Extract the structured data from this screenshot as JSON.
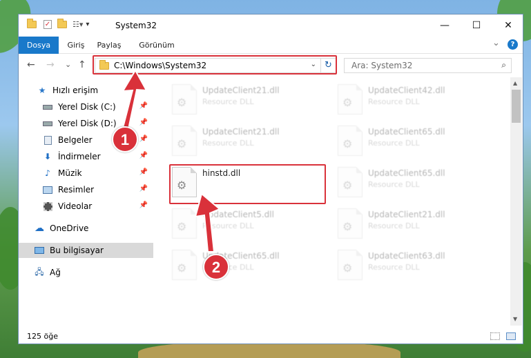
{
  "window": {
    "title": "System32",
    "controls": {
      "minimize": "—",
      "maximize": "☐",
      "close": "✕"
    }
  },
  "ribbon": {
    "tabs": [
      {
        "label": "Dosya"
      },
      {
        "label": "Giriş"
      },
      {
        "label": "Paylaş"
      },
      {
        "label": "Görünüm"
      }
    ],
    "help_label": "?",
    "expand_label": "⌄"
  },
  "navigation": {
    "back": "←",
    "forward": "→",
    "recent": "⌄",
    "up": "↑",
    "address": "C:\\Windows\\System32",
    "refresh": "↻",
    "search_placeholder": "Ara: System32",
    "search_icon": "⌕"
  },
  "sidebar": {
    "items": [
      {
        "label": "Hızlı erişim",
        "icon": "star-icon"
      },
      {
        "label": "Yerel Disk (C:)",
        "icon": "drive-icon",
        "pinned": true
      },
      {
        "label": "Yerel Disk (D:)",
        "icon": "drive-icon",
        "pinned": true
      },
      {
        "label": "Belgeler",
        "icon": "documents-icon",
        "pinned": true
      },
      {
        "label": "İndirmeler",
        "icon": "download-icon",
        "pinned": true
      },
      {
        "label": "Müzik",
        "icon": "music-icon",
        "pinned": true
      },
      {
        "label": "Resimler",
        "icon": "pictures-icon",
        "pinned": true
      },
      {
        "label": "Videolar",
        "icon": "videos-icon",
        "pinned": true
      },
      {
        "label": "OneDrive",
        "icon": "cloud-icon"
      },
      {
        "label": "Bu bilgisayar",
        "icon": "computer-icon",
        "selected": true
      },
      {
        "label": "Ağ",
        "icon": "network-icon"
      }
    ]
  },
  "files": [
    {
      "name": "UpdateClient21.dll",
      "desc": "Resource DLL"
    },
    {
      "name": "UpdateClient42.dll",
      "desc": "Resource DLL"
    },
    {
      "name": "UpdateClient21.dll",
      "desc": "Resource DLL"
    },
    {
      "name": "UpdateClient65.dll",
      "desc": "Resource DLL"
    },
    {
      "name": "hinstd.dll",
      "desc": ""
    },
    {
      "name": "UpdateClient65.dll",
      "desc": "Resource DLL"
    },
    {
      "name": "UpdateClient5.dll",
      "desc": "Resource DLL"
    },
    {
      "name": "UpdateClient21.dll",
      "desc": "Resource DLL"
    },
    {
      "name": "UpdateClient65.dll",
      "desc": "Resource DLL"
    },
    {
      "name": "UpdateClient63.dll",
      "desc": "Resource DLL"
    }
  ],
  "status": {
    "count": "125 öğe"
  },
  "annotations": {
    "step1": "1",
    "step2": "2"
  },
  "colors": {
    "accent": "#1979ca",
    "highlight": "#d9313a"
  }
}
